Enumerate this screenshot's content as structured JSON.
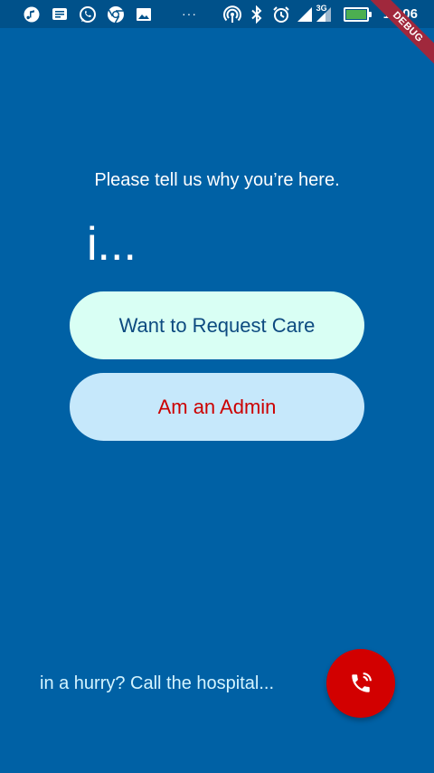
{
  "status_bar": {
    "time": "19:06",
    "network_label": "3G",
    "overflow_dots": "···",
    "left_icons": [
      "music-icon",
      "message-icon",
      "whatsapp-icon",
      "chrome-icon",
      "image-icon"
    ],
    "right_icons": [
      "hotspot-icon",
      "bluetooth-icon",
      "alarm-icon",
      "signal-icon",
      "battery-icon"
    ]
  },
  "debug_banner": "DEBUG",
  "main": {
    "prompt": "Please tell us why you’re here.",
    "i_text": "i...",
    "request_care_label": "Want to Request Care",
    "admin_label": "Am an Admin"
  },
  "footer": {
    "hurry_text": "in a hurry? Call the hospital...",
    "call_icon": "phone-call-icon"
  },
  "colors": {
    "background": "#0061a5",
    "request_button_bg": "#d9fff4",
    "request_button_text": "#0d4a80",
    "admin_button_bg": "#c6e8fb",
    "admin_button_text": "#cc0000",
    "call_button_bg": "#d20000"
  }
}
